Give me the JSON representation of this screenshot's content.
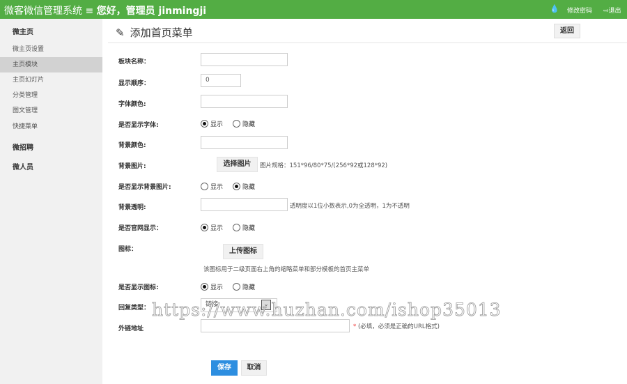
{
  "header": {
    "system_name": "微客微信管理系统",
    "menu_icon": "≡",
    "greeting": "您好，管理员 jinmingji",
    "drop_icon": "drop-icon",
    "change_password": "修改密码",
    "logout": "退出"
  },
  "sidebar": {
    "items": [
      {
        "label": "微主页",
        "type": "group"
      },
      {
        "label": "微主页设置"
      },
      {
        "label": "主页模块",
        "active": true
      },
      {
        "label": "主页幻灯片"
      },
      {
        "label": "分类管理"
      },
      {
        "label": "图文管理"
      },
      {
        "label": "快捷菜单"
      },
      {
        "label": "微招聘",
        "type": "group"
      },
      {
        "label": "微人员",
        "type": "group"
      }
    ]
  },
  "page": {
    "title": "添加首页菜单",
    "back": "返回"
  },
  "form": {
    "block_name": {
      "label": "板块名称：",
      "value": ""
    },
    "order": {
      "label": "显示顺序：",
      "value": "0"
    },
    "font_color": {
      "label": "字体颜色:",
      "value": ""
    },
    "show_font": {
      "label": "是否显示字体:",
      "opt1": "显示",
      "opt2": "隐藏",
      "selected": "显示"
    },
    "bg_color": {
      "label": "背景颜色:",
      "value": ""
    },
    "bg_image": {
      "label": "背景图片:",
      "button": "选择图片",
      "hint": "图片规格：151*96/80*75/(256*92或128*92)"
    },
    "show_bg_image": {
      "label": "是否显示背景图片:",
      "opt1": "显示",
      "opt2": "隐藏",
      "selected": "隐藏"
    },
    "bg_alpha": {
      "label": "背景透明:",
      "value": "",
      "hint": "透明度以1位小数表示,0为全透明，1为不透明"
    },
    "site_show": {
      "label": "是否官网显示：",
      "opt1": "显示",
      "opt2": "隐藏",
      "selected": "显示"
    },
    "icon": {
      "label": "图标：",
      "button": "上传图标",
      "hint": "该图标用于二级页面右上角的缩略菜单和部分模板的首页主菜单"
    },
    "show_icon": {
      "label": "是否显示图标:",
      "opt1": "显示",
      "opt2": "隐藏",
      "selected": "显示"
    },
    "reply_type": {
      "label": "回复类型：",
      "value": "链接"
    },
    "link": {
      "label": "外链地址",
      "value": "",
      "required": "*",
      "hint": "(必填，必须是正确的URL格式)"
    },
    "save": "保存",
    "cancel": "取消"
  },
  "watermark": "https://www.huzhan.com/ishop35013"
}
